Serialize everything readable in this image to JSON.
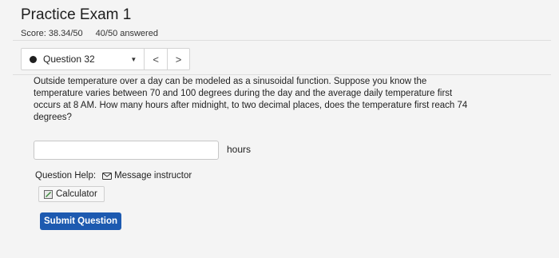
{
  "header": {
    "title": "Practice Exam 1",
    "score": "Score: 38.34/50",
    "answered": "40/50 answered"
  },
  "question_nav": {
    "selected": "Question 32",
    "prev_symbol": "<",
    "next_symbol": ">"
  },
  "question": {
    "text": "Outside temperature over a day can be modeled as a sinusoidal function. Suppose you know the temperature varies between 70 and 100 degrees during the day and the average daily temperature first occurs at 8 AM. How many hours after midnight, to two decimal places, does the temperature first reach 74 degrees?",
    "answer_value": "",
    "unit": "hours"
  },
  "help": {
    "label": "Question Help:",
    "message_link": "Message instructor",
    "calculator": "Calculator"
  },
  "submit_label": "Submit Question",
  "colors": {
    "accent": "#1d5ab0",
    "background": "#f4f4f4"
  }
}
